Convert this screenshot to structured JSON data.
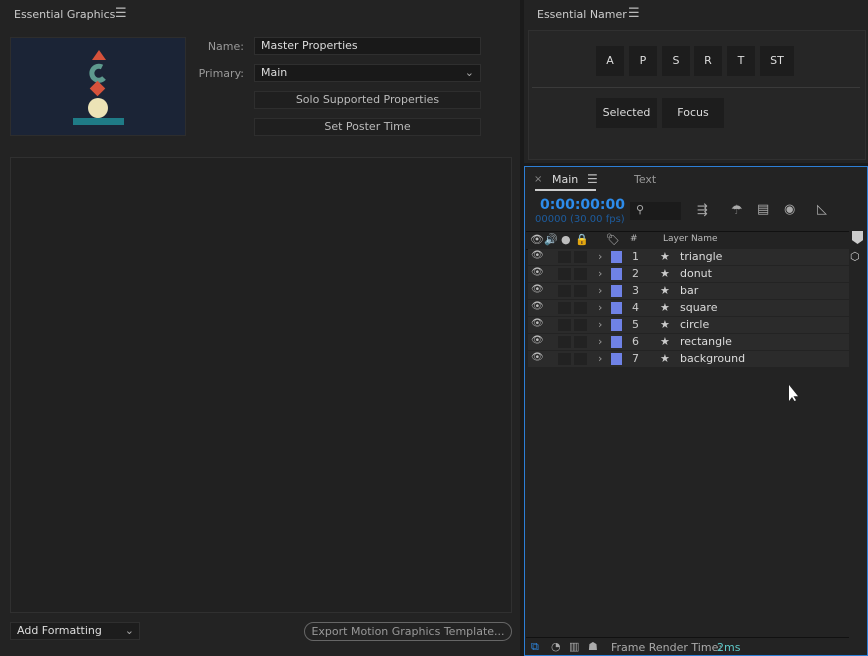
{
  "essential_graphics": {
    "title": "Essential Graphics",
    "name_label": "Name:",
    "name_value": "Master Properties",
    "primary_label": "Primary:",
    "primary_value": "Main",
    "solo_button": "Solo Supported Properties",
    "poster_button": "Set Poster Time",
    "add_formatting": "Add Formatting",
    "export_button": "Export Motion Graphics Template..."
  },
  "essential_namer": {
    "title": "Essential Namer",
    "buttons": [
      "A",
      "P",
      "S",
      "R",
      "T",
      "ST"
    ],
    "mode_buttons": [
      "Selected",
      "Focus",
      ""
    ]
  },
  "timeline": {
    "tabs": [
      {
        "label": "Main",
        "active": true
      },
      {
        "label": "Text",
        "active": false
      }
    ],
    "timecode": "0:00:00:00",
    "frames": "00000 (30.00 fps)",
    "columns": {
      "number": "#",
      "layer_name": "Layer Name"
    },
    "layers": [
      {
        "num": "1",
        "name": "triangle"
      },
      {
        "num": "2",
        "name": "donut"
      },
      {
        "num": "3",
        "name": "bar"
      },
      {
        "num": "4",
        "name": "square"
      },
      {
        "num": "5",
        "name": "circle"
      },
      {
        "num": "6",
        "name": "rectangle"
      },
      {
        "num": "7",
        "name": "background"
      }
    ],
    "label_color": "#6f82e6",
    "accent": "#2d8ceb",
    "footer": {
      "render_label": "Frame Render Time:",
      "render_value": "2ms"
    }
  }
}
